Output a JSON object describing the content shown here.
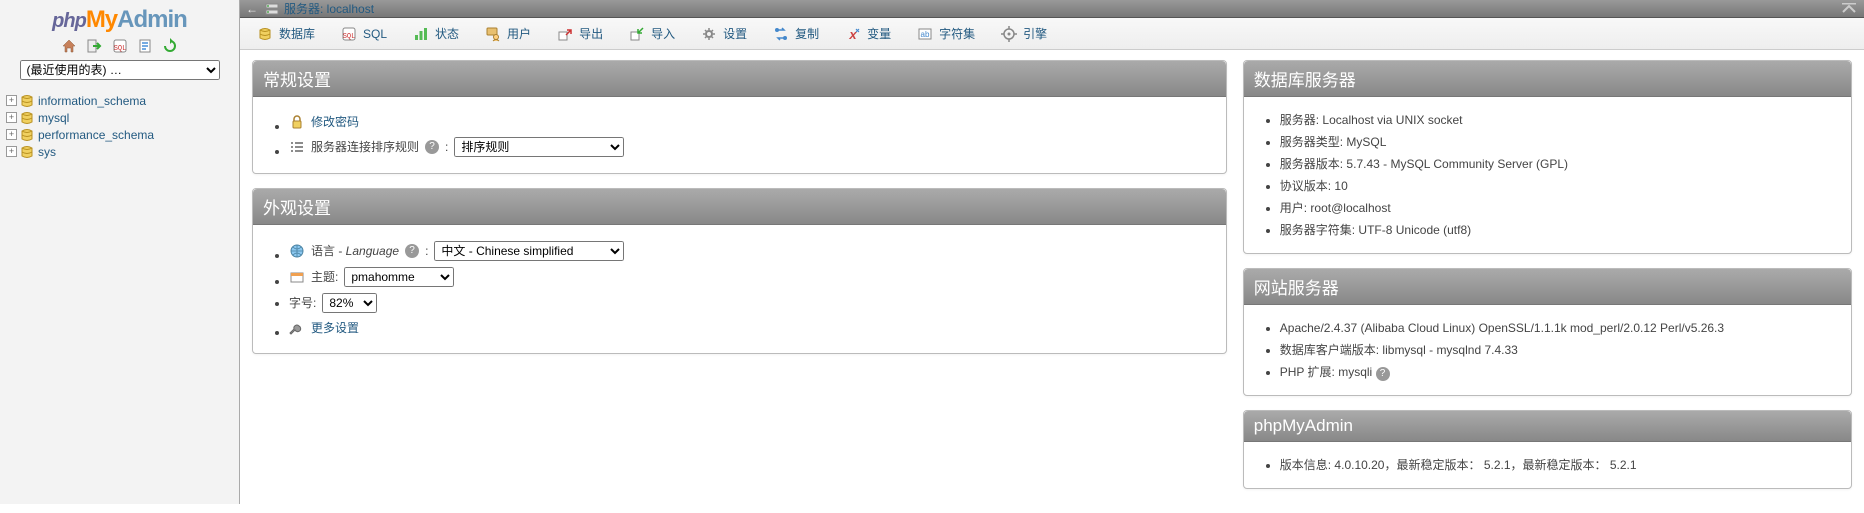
{
  "logo": {
    "p": "php",
    "my": "My",
    "admin": "Admin"
  },
  "nav": {
    "recent_placeholder": "(最近使用的表) …",
    "dbs": [
      "information_schema",
      "mysql",
      "performance_schema",
      "sys"
    ]
  },
  "topbar": {
    "server_label": "服务器: ",
    "server_name": "localhost"
  },
  "tabs": [
    {
      "id": "databases",
      "label": "数据库"
    },
    {
      "id": "sql",
      "label": "SQL"
    },
    {
      "id": "status",
      "label": "状态"
    },
    {
      "id": "users",
      "label": "用户"
    },
    {
      "id": "export",
      "label": "导出"
    },
    {
      "id": "import",
      "label": "导入"
    },
    {
      "id": "settings",
      "label": "设置"
    },
    {
      "id": "replication",
      "label": "复制"
    },
    {
      "id": "variables",
      "label": "变量"
    },
    {
      "id": "charsets",
      "label": "字符集"
    },
    {
      "id": "engines",
      "label": "引擎"
    }
  ],
  "panels": {
    "general": {
      "title": "常规设置",
      "change_pw": "修改密码",
      "collation_label": "服务器连接排序规则",
      "collation_value": "排序规则"
    },
    "appearance": {
      "title": "外观设置",
      "lang_label": "语言 - ",
      "lang_label_i": "Language",
      "lang_value": "中文 - Chinese simplified",
      "theme_label": "主题:",
      "theme_value": "pmahomme",
      "font_label": "字号:",
      "font_value": "82%",
      "more": "更多设置"
    },
    "dbserver": {
      "title": "数据库服务器",
      "items": [
        "服务器: Localhost via UNIX socket",
        "服务器类型: MySQL",
        "服务器版本: 5.7.43 - MySQL Community Server (GPL)",
        "协议版本: 10",
        "用户: root@localhost",
        "服务器字符集: UTF-8 Unicode (utf8)"
      ]
    },
    "webserver": {
      "title": "网站服务器",
      "items": [
        "Apache/2.4.37 (Alibaba Cloud Linux) OpenSSL/1.1.1k mod_perl/2.0.12 Perl/v5.26.3",
        "数据库客户端版本: libmysql - mysqlnd 7.4.33",
        "PHP 扩展: mysqli"
      ]
    },
    "pma": {
      "title": "phpMyAdmin",
      "version": "版本信息: 4.0.10.20，最新稳定版本： 5.2.1，最新稳定版本： 5.2.1"
    }
  }
}
